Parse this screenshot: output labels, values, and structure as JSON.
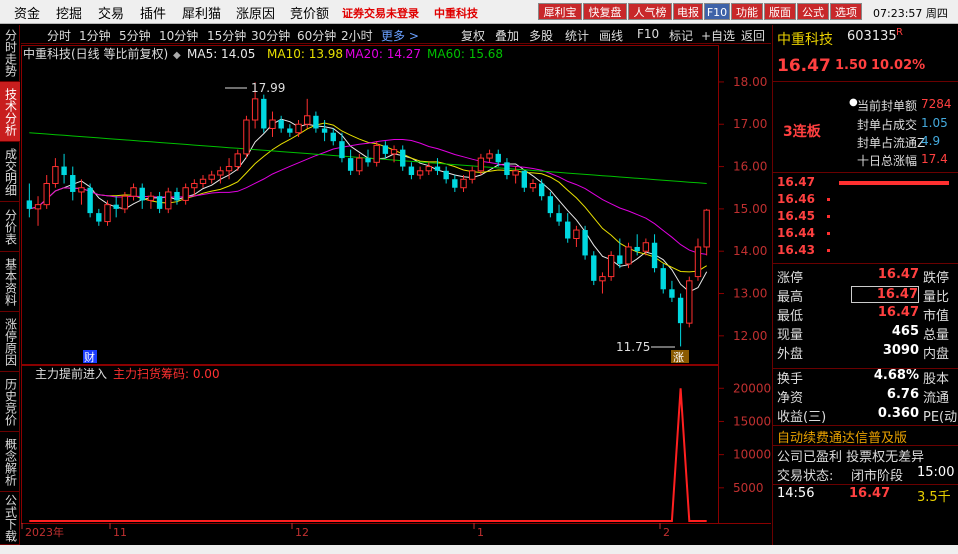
{
  "menu": [
    "资金",
    "挖掘",
    "交易",
    "插件",
    "犀利猫",
    "涨原因",
    "竞价额"
  ],
  "top_notice": "证券交易未登录",
  "top_stock": "中重科技",
  "top_buttons": [
    "犀利宝",
    "快复盘",
    "人气榜",
    "电报",
    "F10",
    "功能",
    "版面",
    "公式",
    "选项"
  ],
  "clock": "07:23:57 周四",
  "left_tabs": [
    "分时走势",
    "技术分析",
    "成交明细",
    "分价表",
    "基本资料",
    "涨停原因",
    "历史竞价",
    "概念解析",
    "公式下载"
  ],
  "periods": [
    "分时",
    "1分钟",
    "5分钟",
    "10分钟",
    "15分钟",
    "30分钟",
    "60分钟",
    "2小时",
    "更多 >"
  ],
  "toolbar": [
    "复权",
    "叠加",
    "多股",
    "统计",
    "画线",
    "F10",
    "标记",
    "+自选",
    "返回"
  ],
  "chart_header": {
    "title": "中重科技(日线 等比前复权)",
    "ma5": "MA5: 14.05",
    "ma10": "MA10: 13.98",
    "ma20": "MA20: 14.27",
    "ma60": "MA60: 15.68"
  },
  "annotations": {
    "high": "17.99",
    "low": "11.75",
    "cai": "财",
    "zhang": "涨"
  },
  "indicator_header": {
    "name": "主力提前进入",
    "label": "主力扫货筹码: 0.00"
  },
  "colors": {
    "up": "#ff3030",
    "down": "#00d8e0",
    "ma5": "#e8e8e8",
    "ma10": "#e8e000",
    "ma20": "#e000e0",
    "ma60": "#00c000",
    "border": "#8a0000"
  },
  "chart_data": [
    {
      "type": "candlestick",
      "title": "中重科技(日线 等比前复权)",
      "ylim": [
        11.5,
        18.4
      ],
      "yticks": [
        12.0,
        13.0,
        14.0,
        15.0,
        16.0,
        17.0,
        18.0
      ],
      "xticks": [
        "2023年",
        "11",
        "12",
        "1",
        "2"
      ],
      "ohlc": [
        [
          15.2,
          15.6,
          14.8,
          15.0
        ],
        [
          15.0,
          15.3,
          14.6,
          15.1
        ],
        [
          15.1,
          15.8,
          15.0,
          15.6
        ],
        [
          15.6,
          16.2,
          15.5,
          16.0
        ],
        [
          16.0,
          16.3,
          15.6,
          15.8
        ],
        [
          15.8,
          16.0,
          15.2,
          15.4
        ],
        [
          15.4,
          15.7,
          15.1,
          15.5
        ],
        [
          15.5,
          15.6,
          14.8,
          14.9
        ],
        [
          14.9,
          15.0,
          14.6,
          14.7
        ],
        [
          14.7,
          15.2,
          14.6,
          15.1
        ],
        [
          15.1,
          15.3,
          14.8,
          15.0
        ],
        [
          15.0,
          15.4,
          14.9,
          15.3
        ],
        [
          15.3,
          15.6,
          15.2,
          15.5
        ],
        [
          15.5,
          15.6,
          15.0,
          15.2
        ],
        [
          15.2,
          15.4,
          15.0,
          15.3
        ],
        [
          15.3,
          15.4,
          14.9,
          15.0
        ],
        [
          15.0,
          15.5,
          14.9,
          15.4
        ],
        [
          15.4,
          15.5,
          15.1,
          15.2
        ],
        [
          15.2,
          15.6,
          15.1,
          15.5
        ],
        [
          15.5,
          15.7,
          15.3,
          15.6
        ],
        [
          15.6,
          15.8,
          15.5,
          15.7
        ],
        [
          15.7,
          15.9,
          15.6,
          15.8
        ],
        [
          15.8,
          16.0,
          15.6,
          15.9
        ],
        [
          15.9,
          16.2,
          15.7,
          16.0
        ],
        [
          16.0,
          16.4,
          15.9,
          16.3
        ],
        [
          16.3,
          17.2,
          16.2,
          17.1
        ],
        [
          17.1,
          17.99,
          16.9,
          17.6
        ],
        [
          17.6,
          17.7,
          16.8,
          16.9
        ],
        [
          16.9,
          17.3,
          16.7,
          17.1
        ],
        [
          17.1,
          17.2,
          16.8,
          16.9
        ],
        [
          16.9,
          17.0,
          16.7,
          16.8
        ],
        [
          16.8,
          17.1,
          16.7,
          17.0
        ],
        [
          17.0,
          17.6,
          16.9,
          17.2
        ],
        [
          17.2,
          17.3,
          16.8,
          16.9
        ],
        [
          16.9,
          17.1,
          16.6,
          16.8
        ],
        [
          16.8,
          16.9,
          16.5,
          16.6
        ],
        [
          16.6,
          16.8,
          16.1,
          16.2
        ],
        [
          16.2,
          16.4,
          15.8,
          15.9
        ],
        [
          15.9,
          16.3,
          15.8,
          16.2
        ],
        [
          16.2,
          16.4,
          16.0,
          16.1
        ],
        [
          16.1,
          16.6,
          16.0,
          16.5
        ],
        [
          16.5,
          16.6,
          16.2,
          16.3
        ],
        [
          16.3,
          16.5,
          16.1,
          16.4
        ],
        [
          16.4,
          16.5,
          15.9,
          16.0
        ],
        [
          16.0,
          16.1,
          15.7,
          15.8
        ],
        [
          15.8,
          16.0,
          15.7,
          15.9
        ],
        [
          15.9,
          16.1,
          15.8,
          16.0
        ],
        [
          16.0,
          16.2,
          15.8,
          15.9
        ],
        [
          15.9,
          16.0,
          15.6,
          15.7
        ],
        [
          15.7,
          15.8,
          15.4,
          15.5
        ],
        [
          15.5,
          15.8,
          15.4,
          15.7
        ],
        [
          15.7,
          16.0,
          15.6,
          15.9
        ],
        [
          15.9,
          16.3,
          15.8,
          16.2
        ],
        [
          16.2,
          16.4,
          16.1,
          16.3
        ],
        [
          16.3,
          16.4,
          16.0,
          16.1
        ],
        [
          16.1,
          16.2,
          15.7,
          15.8
        ],
        [
          15.8,
          16.0,
          15.6,
          15.9
        ],
        [
          15.9,
          15.9,
          15.4,
          15.5
        ],
        [
          15.5,
          15.7,
          15.4,
          15.6
        ],
        [
          15.6,
          15.7,
          15.2,
          15.3
        ],
        [
          15.3,
          15.4,
          14.8,
          14.9
        ],
        [
          14.9,
          15.1,
          14.6,
          14.7
        ],
        [
          14.7,
          14.9,
          14.2,
          14.3
        ],
        [
          14.3,
          14.6,
          14.1,
          14.5
        ],
        [
          14.5,
          14.6,
          13.8,
          13.9
        ],
        [
          13.9,
          14.0,
          13.2,
          13.3
        ],
        [
          13.3,
          13.5,
          13.0,
          13.4
        ],
        [
          13.4,
          14.0,
          13.3,
          13.9
        ],
        [
          13.9,
          14.3,
          13.6,
          13.7
        ],
        [
          13.7,
          14.2,
          13.6,
          14.1
        ],
        [
          14.1,
          14.4,
          13.9,
          14.0
        ],
        [
          14.0,
          14.3,
          13.9,
          14.2
        ],
        [
          14.2,
          14.4,
          13.5,
          13.6
        ],
        [
          13.6,
          13.7,
          13.0,
          13.1
        ],
        [
          13.1,
          13.3,
          12.8,
          12.9
        ],
        [
          12.9,
          13.0,
          11.75,
          12.3
        ],
        [
          12.3,
          13.4,
          12.2,
          13.3
        ],
        [
          13.4,
          14.3,
          13.3,
          14.1
        ],
        [
          14.1,
          15.0,
          13.9,
          14.97
        ]
      ],
      "ma60": [
        16.8,
        16.5,
        16.2,
        15.9,
        15.6
      ]
    },
    {
      "type": "line",
      "title": "主力提前进入",
      "ylim": [
        0,
        22000
      ],
      "yticks": [
        5000,
        10000,
        15000,
        20000
      ],
      "values_tail": [
        0,
        0,
        0,
        0,
        20000,
        0,
        0,
        0
      ]
    }
  ],
  "right_panel": {
    "name": "中重科技",
    "code": "603135",
    "tag": "R",
    "price": "16.47",
    "change": "1.50",
    "change_pct": "10.02%",
    "lianban": "3连板",
    "seal_rows": [
      {
        "label": "当前封单额",
        "value": "7284"
      },
      {
        "label": "封单占成交",
        "value": "1.05"
      },
      {
        "label": "封单占流通Z",
        "value": "4.9"
      },
      {
        "label": "十日总涨幅",
        "value": "17.4"
      }
    ],
    "bids": [
      "16.47",
      "16.46",
      "16.45",
      "16.44",
      "16.43"
    ],
    "stats": [
      {
        "k1": "涨停",
        "v1": "16.47",
        "k2": "跌停"
      },
      {
        "k1": "最高",
        "v1": "16.47",
        "k2": "量比"
      },
      {
        "k1": "最低",
        "v1": "16.47",
        "k2": "市值"
      },
      {
        "k1": "现量",
        "v1": "465",
        "k2": "总量"
      },
      {
        "k1": "外盘",
        "v1": "3090",
        "k2": "内盘"
      }
    ],
    "stats2": [
      {
        "k1": "换手",
        "v1": "4.68%",
        "k2": "股本"
      },
      {
        "k1": "净资",
        "v1": "6.76",
        "k2": "流通"
      },
      {
        "k1": "收益(三)",
        "v1": "0.360",
        "k2": "PE(动)"
      }
    ],
    "ad_line": "自动续费通达信普及版",
    "info1": "公司已盈利 投票权无差异",
    "status_label": "交易状态:",
    "status_value": "闭市阶段",
    "status_time": "15:00",
    "tick_time": "14:56",
    "tick_price": "16.47",
    "tick_vol": "3.5千"
  }
}
